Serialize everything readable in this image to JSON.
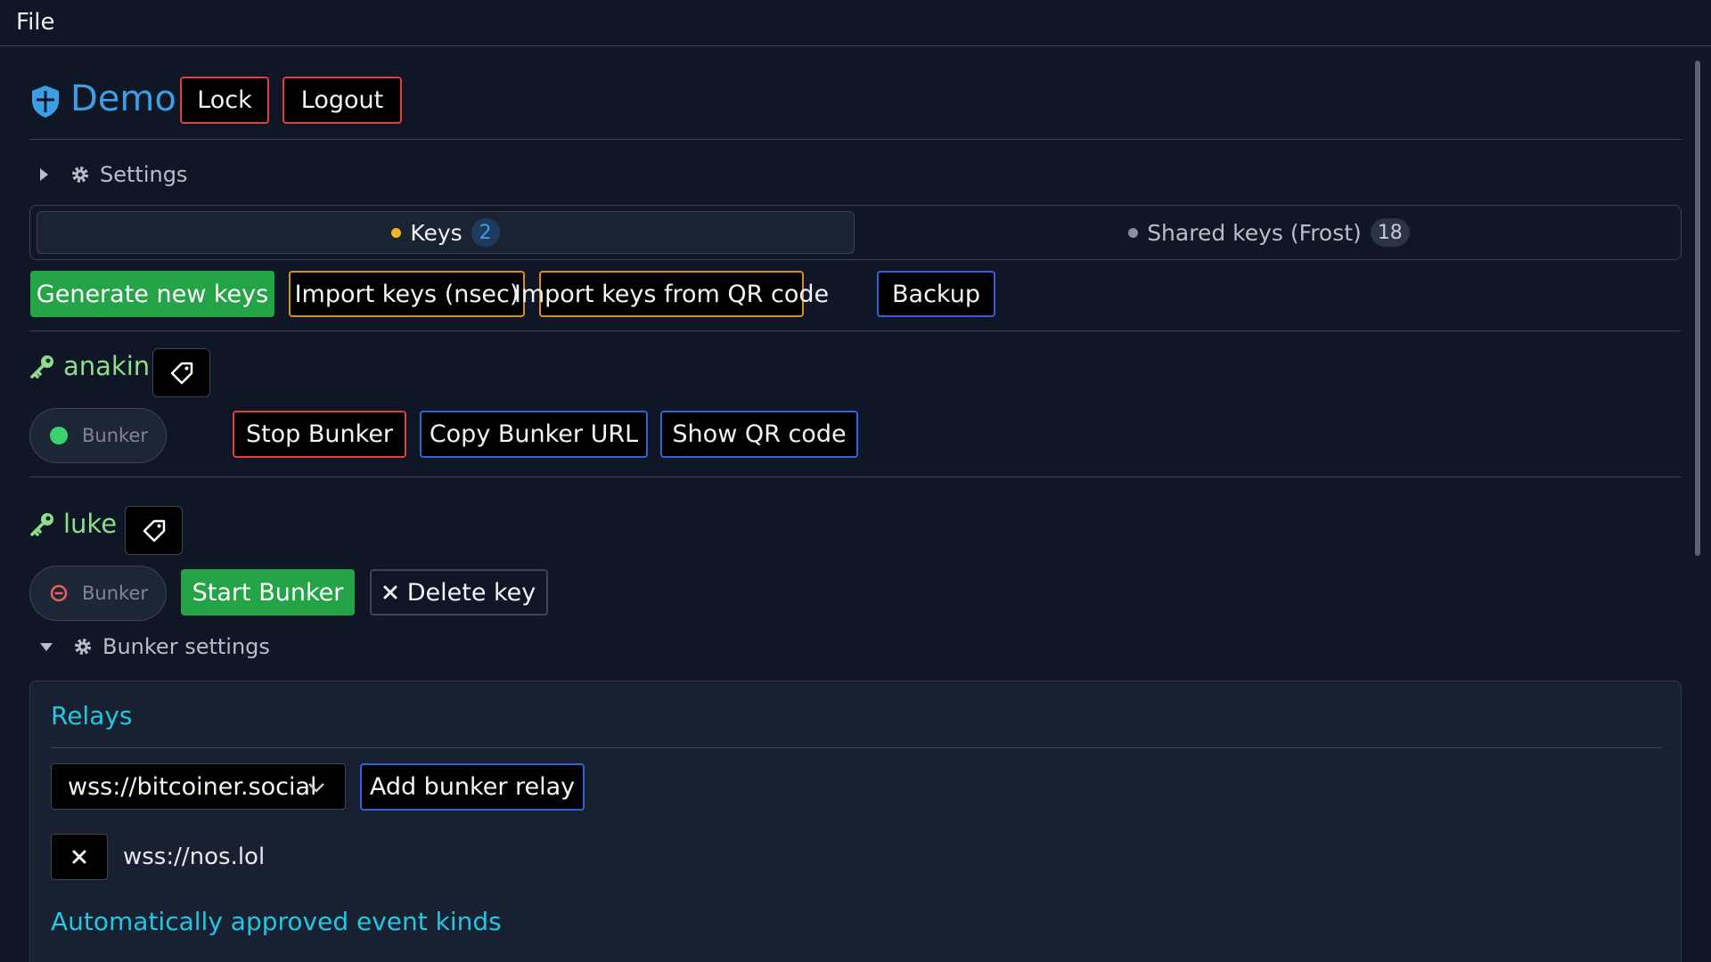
{
  "menubar": {
    "file": "File"
  },
  "header": {
    "title": "Demo",
    "lock": "Lock",
    "logout": "Logout"
  },
  "settings": {
    "label": "Settings"
  },
  "tabs": [
    {
      "label": "Keys",
      "count": "2",
      "dot_color": "#f0b429"
    },
    {
      "label": "Shared keys (Frost)",
      "count": "18",
      "dot_color": "#8a909a"
    }
  ],
  "actions": {
    "generate": "Generate new keys",
    "import_nsec": "Import keys (nsec)",
    "import_qr": "Import keys from QR code",
    "backup": "Backup"
  },
  "keys": [
    {
      "name": "anakin",
      "bunker_label": "Bunker",
      "bunker_status": "running",
      "buttons": {
        "stop": "Stop Bunker",
        "copy_url": "Copy Bunker URL",
        "show_qr": "Show QR code"
      }
    },
    {
      "name": "luke",
      "bunker_label": "Bunker",
      "bunker_status": "stopped",
      "buttons": {
        "start": "Start Bunker",
        "delete": "Delete key"
      }
    }
  ],
  "bunker_settings": {
    "label": "Bunker settings",
    "relays_title": "Relays",
    "relay_select_value": "wss://bitcoiner.social",
    "add_relay": "Add bunker relay",
    "relays": [
      "wss://nos.lol"
    ],
    "approved_kinds_title": "Automatically approved event kinds"
  },
  "colors": {
    "accent_blue": "#3b9fe6",
    "key_green": "#8fdc8a",
    "success": "#25a347",
    "danger": "#e0403b",
    "section_cyan": "#22c7e0"
  }
}
